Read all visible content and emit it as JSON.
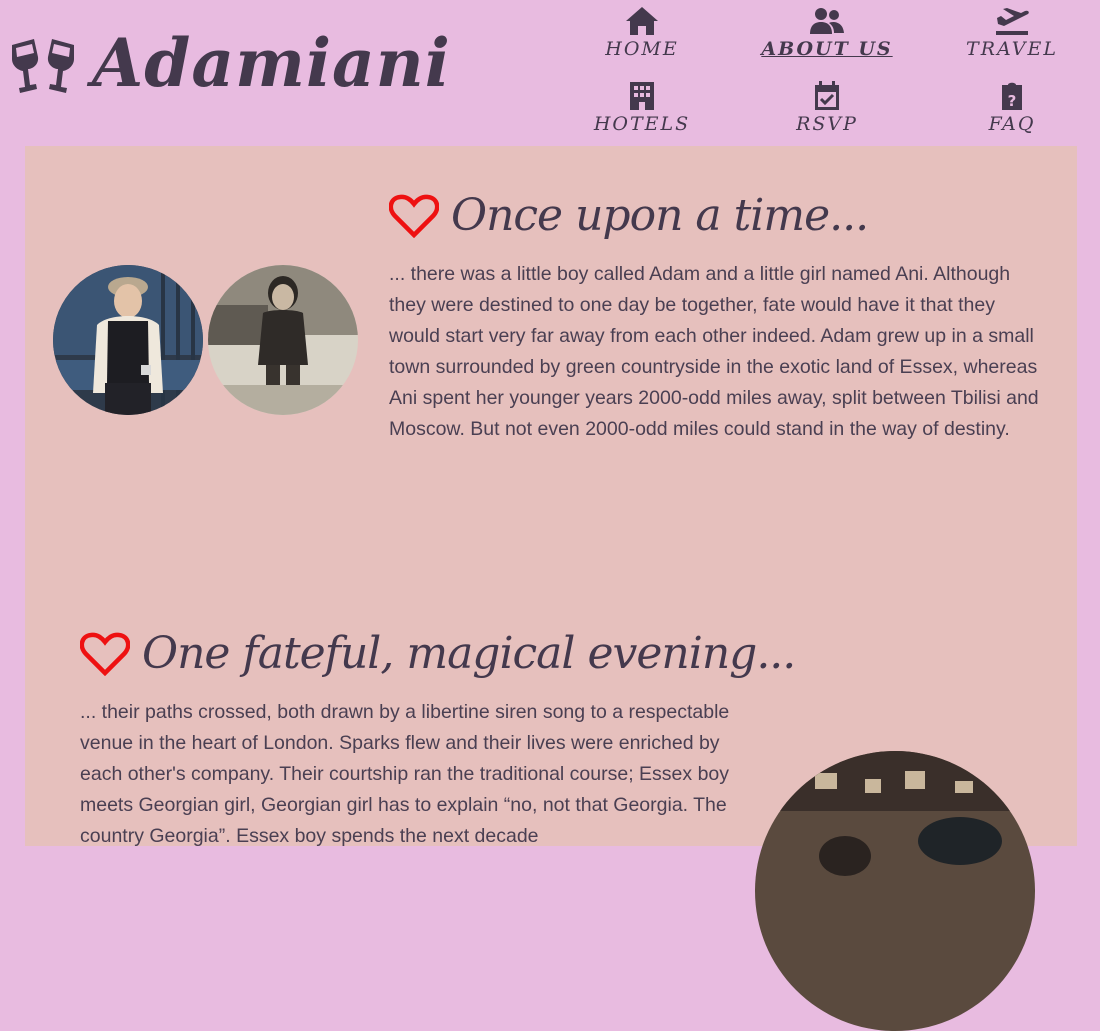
{
  "header": {
    "brand": "Adamiani",
    "nav": [
      {
        "label": "HOME",
        "icon": "home-icon",
        "active": false
      },
      {
        "label": "ABOUT US",
        "icon": "users-icon",
        "active": true
      },
      {
        "label": "TRAVEL",
        "icon": "plane-departure-icon",
        "active": false
      },
      {
        "label": "HOTELS",
        "icon": "hotel-icon",
        "active": false
      },
      {
        "label": "RSVP",
        "icon": "calendar-check-icon",
        "active": false
      },
      {
        "label": "FAQ",
        "icon": "clipboard-question-icon",
        "active": false
      }
    ]
  },
  "sections": [
    {
      "title": "Once upon a time...",
      "body": "... there was a little boy called Adam and a little girl named Ani. Although they were destined to one day be together, fate would have it that they would start very far away from each other indeed. Adam grew up in a small town surrounded by green countryside in the exotic land of Essex, whereas Ani spent her younger years 2000-odd miles away, split between Tbilisi and Moscow. But not even 2000-odd miles could stand in the way of destiny."
    },
    {
      "title": "One fateful, magical evening...",
      "body": "... their paths crossed, both drawn by a libertine siren song to a respectable venue in the heart of London. Sparks flew and their lives were enriched by each other's company. Their courtship ran the traditional course; Essex boy meets Georgian girl, Georgian girl has to explain “no, not that Georgia. The country Georgia”. Essex boy spends the next decade"
    }
  ],
  "colors": {
    "background": "#e8bbe0",
    "card": "#e6c0bd",
    "text": "#44394d",
    "heart": "#ee1111"
  }
}
